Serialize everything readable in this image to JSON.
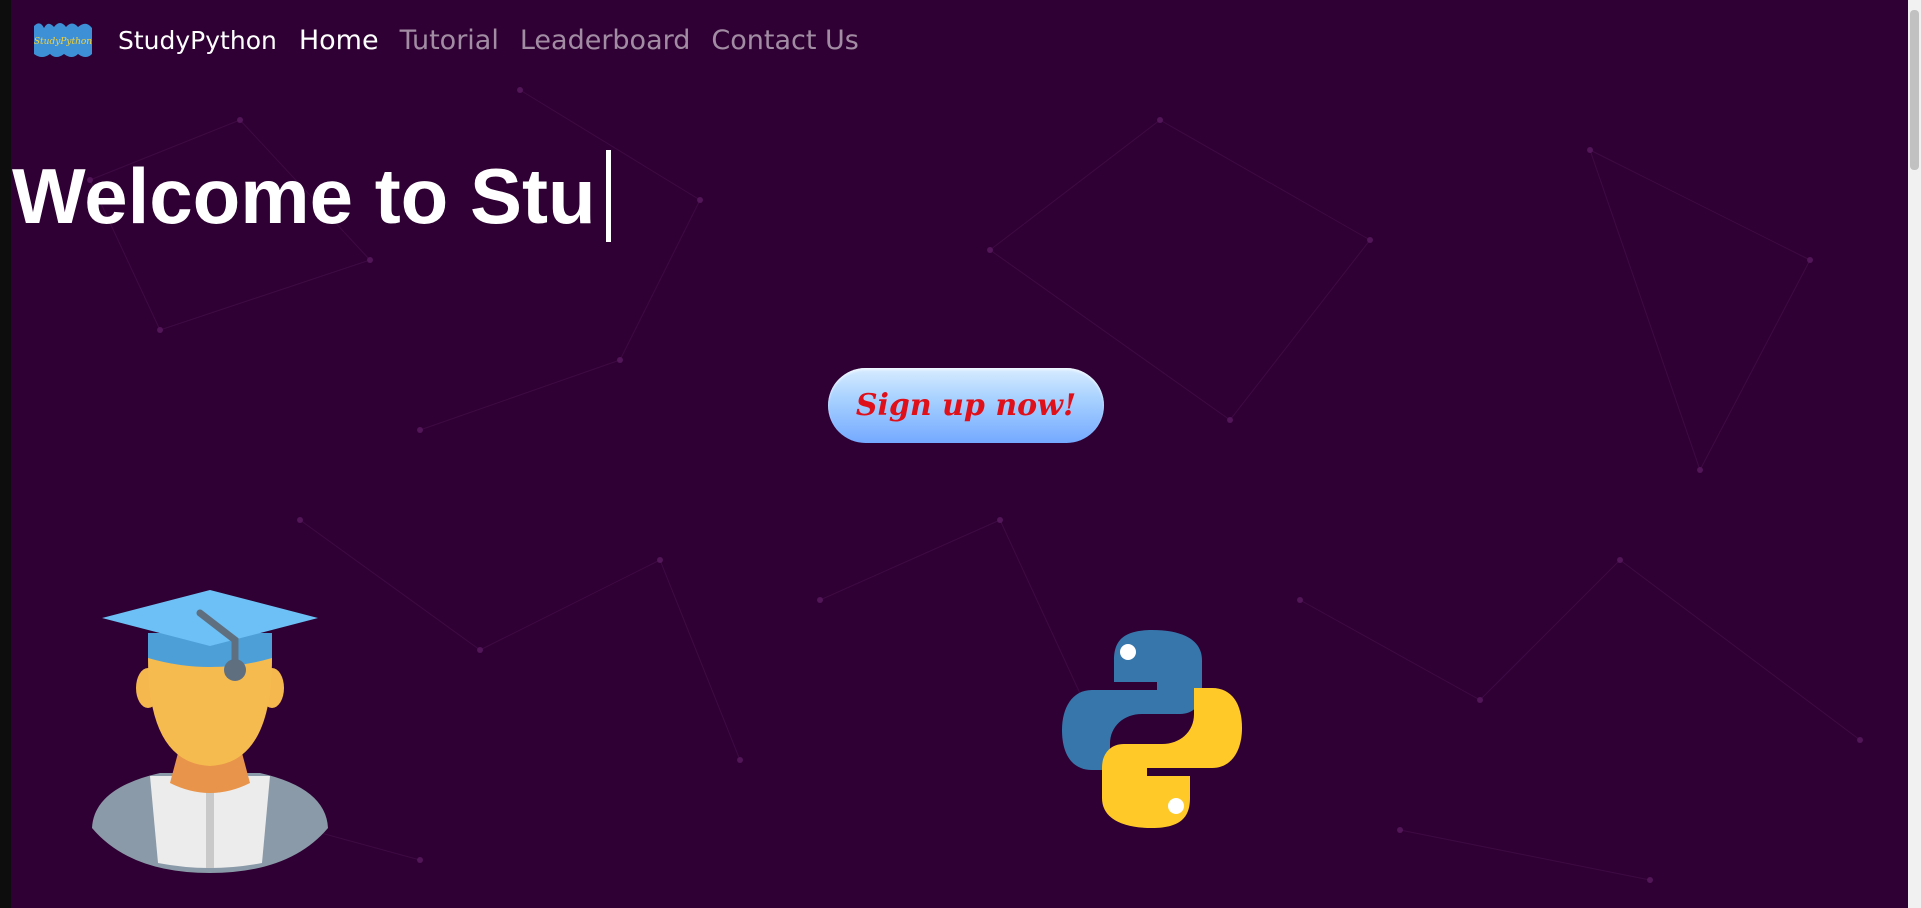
{
  "navbar": {
    "brand": "StudyPython",
    "logo_text": "StudyPython",
    "links": [
      {
        "label": "Home",
        "active": true
      },
      {
        "label": "Tutorial",
        "active": false
      },
      {
        "label": "Leaderboard",
        "active": false
      },
      {
        "label": "Contact Us",
        "active": false
      }
    ]
  },
  "hero": {
    "headline": "Welcome to Stu",
    "signup_label": "Sign up now!"
  },
  "colors": {
    "background": "#2f0033",
    "button_text": "#e0101a",
    "nav_inactive": "rgba(255,255,255,0.55)"
  },
  "icons": [
    "graduate-illustration",
    "python-logo-icon"
  ]
}
